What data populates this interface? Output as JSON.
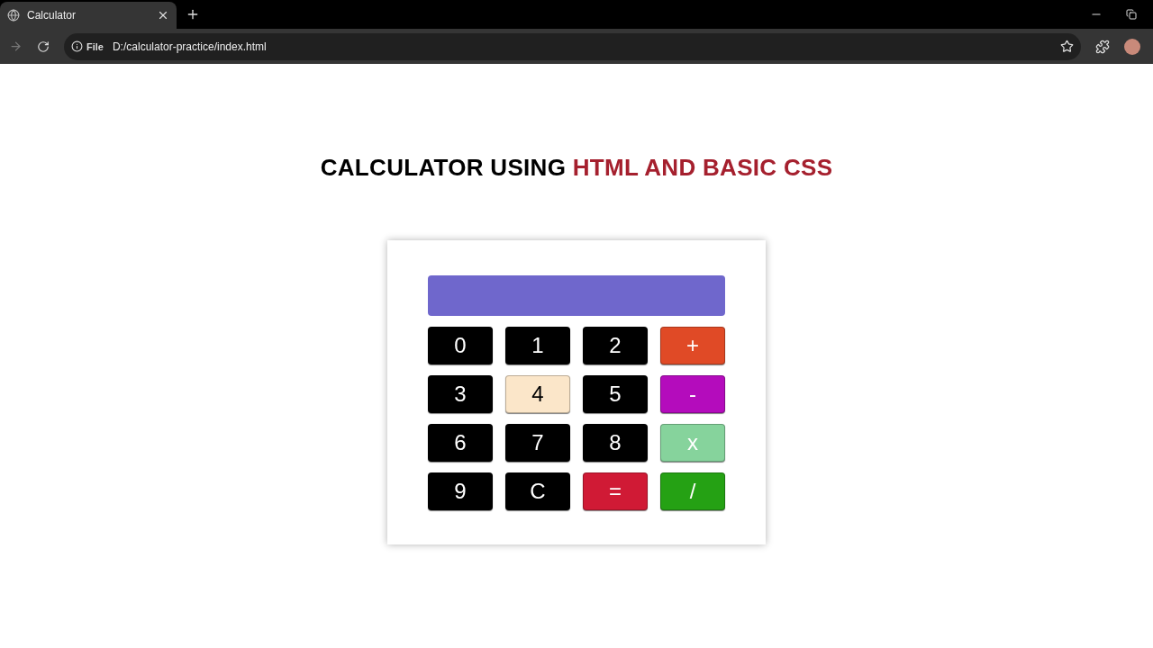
{
  "browser": {
    "tab_title": "Calculator",
    "address_badge": "File",
    "url": "D:/calculator-practice/index.html"
  },
  "heading": {
    "lead": "CALCULATOR USING",
    "highlight": "HTML AND BASIC CSS"
  },
  "keys": [
    {
      "label": "0",
      "color": "#000000",
      "hovered": false
    },
    {
      "label": "1",
      "color": "#000000",
      "hovered": false
    },
    {
      "label": "2",
      "color": "#000000",
      "hovered": false
    },
    {
      "label": "+",
      "color": "#e04a26",
      "hovered": false
    },
    {
      "label": "3",
      "color": "#000000",
      "hovered": false
    },
    {
      "label": "4",
      "hovered": true
    },
    {
      "label": "5",
      "color": "#000000",
      "hovered": false
    },
    {
      "label": "-",
      "color": "#b40cbc",
      "hovered": false
    },
    {
      "label": "6",
      "color": "#000000",
      "hovered": false
    },
    {
      "label": "7",
      "color": "#000000",
      "hovered": false
    },
    {
      "label": "8",
      "color": "#000000",
      "hovered": false
    },
    {
      "label": "x",
      "color": "#86d39c",
      "hovered": false
    },
    {
      "label": "9",
      "color": "#000000",
      "hovered": false
    },
    {
      "label": "C",
      "color": "#000000",
      "hovered": false
    },
    {
      "label": "=",
      "color": "#d01a35",
      "hovered": false
    },
    {
      "label": "/",
      "color": "#25a114",
      "hovered": false
    }
  ]
}
